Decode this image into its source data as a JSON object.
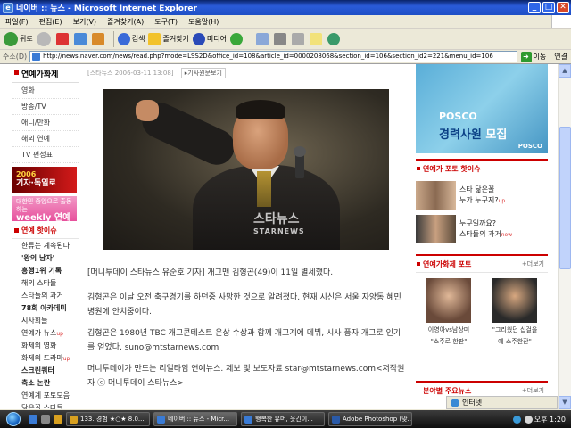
{
  "window": {
    "title": "네이버 :: 뉴스 - Microsoft Internet Explorer",
    "min": "_",
    "max": "□",
    "close": "✕"
  },
  "menu": [
    "파일(F)",
    "편집(E)",
    "보기(V)",
    "즐겨찾기(A)",
    "도구(T)",
    "도움말(H)"
  ],
  "toolbar": {
    "back": "뒤로",
    "search": "검색",
    "favorites": "즐겨찾기",
    "media": "미디어"
  },
  "address": {
    "label": "주소(D)",
    "url": "http://news.naver.com/news/read.php?mode=LSS2D&office_id=108&article_id=0000208068&section_id=106&section_id2=221&menu_id=106",
    "go": "이동",
    "links": "연결"
  },
  "leftnav": {
    "head": "연예가화제",
    "items": [
      "영화",
      "방송/TV",
      "애니/만화",
      "해외 연예",
      "TV 편성표"
    ],
    "banner1": {
      "year": "2006",
      "text": "기자·독일로"
    },
    "banner2": {
      "top": "대한민 중앙으로 출동하는",
      "big": "weekly 연예"
    },
    "hot_head": "연예 핫이슈",
    "hot_items": [
      {
        "text": "한류는 계속된다",
        "bold": false,
        "new": ""
      },
      {
        "text": "'왕의 남자'",
        "bold": true,
        "new": ""
      },
      {
        "text": "흥행1위 기록",
        "bold": true,
        "new": ""
      },
      {
        "text": "해외 스타들",
        "bold": false,
        "new": ""
      },
      {
        "text": "스타들의 과거",
        "bold": false,
        "new": ""
      },
      {
        "text": "78회 아카데미",
        "bold": true,
        "new": ""
      },
      {
        "text": "시사회들",
        "bold": false,
        "new": ""
      },
      {
        "text": "연예가 뉴스",
        "bold": false,
        "new": "up"
      },
      {
        "text": "화제의 영화",
        "bold": false,
        "new": ""
      },
      {
        "text": "화제의 드라마",
        "bold": false,
        "new": "up"
      },
      {
        "text": "스크린쿼터",
        "bold": true,
        "new": ""
      },
      {
        "text": "축소 논란",
        "bold": true,
        "new": ""
      },
      {
        "text": "연예계 포토모음",
        "bold": false,
        "new": ""
      },
      {
        "text": "닮은꼴 스타들",
        "bold": false,
        "new": ""
      },
      {
        "text": "스타 포토",
        "bold": false,
        "new": ""
      }
    ]
  },
  "article": {
    "byline": "[스타뉴스 2006-03-11 13:08]",
    "reporter_btn": "기사원문보기",
    "watermark": "스타뉴스",
    "watermark_en": "STARNEWS",
    "paragraphs": [
      "[머니투데이 스타뉴스 유순호 기자] 개그맨 김형곤(49)이 11일 별세했다.",
      "김형곤은 이날 오전 축구경기를 하던중 사망한 것으로 알려졌다. 현재 시신은 서울 자양동 혜민병원에 안치중이다.",
      "김형곤은 1980년 TBC 개그콘테스트 은상 수상과 함께 개그계에 데뷔, 시사 풍자 개그로 인기를 얻었다. suno@mtstarnews.com",
      "머니투데이가 만드는 리얼타임 연예뉴스. 제보 및 보도자료 star@mtstarnews.com<저작권자 ⓒ 머니투데이 스타뉴스>"
    ]
  },
  "right": {
    "ad": {
      "brand": "POSCO",
      "text_a": "경력사원",
      "text_b": "모집",
      "logo": "POSCO"
    },
    "hot_head": "연예가 포토 핫이슈",
    "hot": [
      {
        "line1": "스타 닮은꼴",
        "line2": "누가 누구지?",
        "tag": "up"
      },
      {
        "line1": "누구일까요?",
        "line2": "스타들의 과거",
        "tag": "new"
      }
    ],
    "photo_head": "연예가화제 포토",
    "photo_more": "+더보기",
    "photos": [
      {
        "cap1": "이영아vs남상미",
        "cap2": "\"소주로 한판\""
      },
      {
        "cap1": "\"그리웠던 십걸을",
        "cap2": "에 소주한잔\""
      }
    ],
    "footer_head": "분야별 주요뉴스",
    "footer_more": "+더보기"
  },
  "status": {
    "zone": "인터넷"
  },
  "taskbar": {
    "tasks": [
      {
        "label": "133. 경험 ★○★ 8.0...",
        "active": false
      },
      {
        "label": "네이버 :: 뉴스 - Micr...",
        "active": true
      },
      {
        "label": "행복한 유머, 웃긴이...",
        "active": false
      },
      {
        "label": "Adobe Photoshop (맞...",
        "active": false
      }
    ],
    "clock": "오후 1:20"
  }
}
